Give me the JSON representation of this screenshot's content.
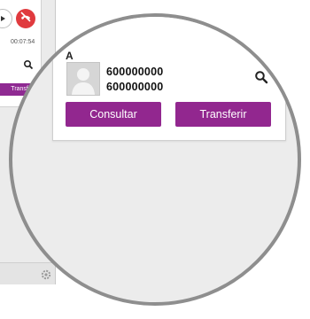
{
  "background_panel": {
    "timer": "00:07:54",
    "transfer_label": "Transferir",
    "icons": {
      "play": "play-icon",
      "hangup": "hangup-icon",
      "search": "search-icon",
      "settings": "gear-icon"
    }
  },
  "magnified": {
    "contact_letter": "A",
    "number_primary": "600000000",
    "number_secondary": "600000000",
    "consult_label": "Consultar",
    "transfer_label": "Transferir",
    "icons": {
      "avatar": "avatar-placeholder-icon",
      "search": "search-icon"
    }
  },
  "colors": {
    "accent": "#92278F",
    "hangup": "#E03A3E",
    "lens_border": "#8E8E8E"
  }
}
